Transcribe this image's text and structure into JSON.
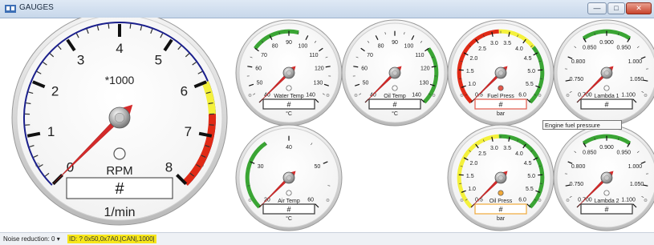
{
  "window": {
    "title": "GAUGES",
    "controls": {
      "minimize": "—",
      "maximize": "□",
      "close": "✕"
    },
    "app_icon": "gauges-app-icon"
  },
  "gauges": [
    {
      "id": "rpm",
      "large": true,
      "label": "RPM",
      "multiplier": "*1000",
      "display": "#",
      "unit": "1/min",
      "value": 0,
      "min": 0,
      "max": 8,
      "tick_labels": [
        "0",
        "1",
        "2",
        "3",
        "4",
        "5",
        "6",
        "7",
        "8"
      ],
      "arc_color": "#1a1f8c",
      "zones": [
        {
          "from": 6,
          "to": 6.6,
          "color": "#f4f13c"
        },
        {
          "from": 6.6,
          "to": 8,
          "color": "#e02a16"
        }
      ],
      "indicator": "off",
      "display_border": "#333333"
    },
    {
      "id": "water-temp",
      "label": "Water Temp",
      "display": "#",
      "unit": "°C",
      "value": 40,
      "min": 40,
      "max": 140,
      "tick_labels": [
        "40",
        "50",
        "60",
        "70",
        "80",
        "90",
        "100",
        "110",
        "120",
        "130",
        "140"
      ],
      "zones": [
        {
          "from": 70,
          "to": 95,
          "color": "#3aa534"
        }
      ],
      "indicator": "off",
      "display_border": "#333333"
    },
    {
      "id": "oil-temp",
      "label": "Oil Temp",
      "display": "#",
      "unit": "°C",
      "value": 40,
      "min": 40,
      "max": 140,
      "tick_labels": [
        "40",
        "50",
        "60",
        "70",
        "80",
        "90",
        "100",
        "110",
        "120",
        "130",
        "140"
      ],
      "zones": [
        {
          "from": 110,
          "to": 140,
          "color": "#3aa534"
        }
      ],
      "indicator": "off",
      "display_border": "#333333"
    },
    {
      "id": "fuel-press",
      "label": "Fuel Press",
      "display": "#",
      "unit": "bar",
      "value": 0.5,
      "min": 0.5,
      "max": 6,
      "tick_labels": [
        "0.5",
        "1.0",
        "1.5",
        "2.0",
        "2.5",
        "3.0",
        "3.5",
        "4.0",
        "4.5",
        "5.0",
        "5.5",
        "6.0"
      ],
      "zones": [
        {
          "from": 0.5,
          "to": 3.2,
          "color": "#e02a16"
        },
        {
          "from": 3.2,
          "to": 4.3,
          "color": "#f4f13c"
        },
        {
          "from": 4.3,
          "to": 6,
          "color": "#3aa534"
        }
      ],
      "indicator": "red",
      "display_border": "#e2584a"
    },
    {
      "id": "lambda-1",
      "label": "Lambda 1",
      "display": "#",
      "unit": "",
      "value": 0.7,
      "min": 0.7,
      "max": 1.1,
      "tick_labels": [
        "0.700",
        "0.750",
        "0.800",
        "0.850",
        "0.900",
        "0.950",
        "1.000",
        "1.050",
        "1.100"
      ],
      "zones": [
        {
          "from": 0.85,
          "to": 0.95,
          "color": "#3aa534"
        }
      ],
      "indicator": "off",
      "display_border": "#333333"
    },
    {
      "id": "air-temp",
      "label": "Air Temp",
      "display": "#",
      "unit": "°C",
      "value": 20,
      "min": 20,
      "max": 60,
      "tick_labels": [
        "20",
        "30",
        "40",
        "50",
        "60"
      ],
      "zones": [
        {
          "from": 20,
          "to": 35,
          "color": "#3aa534"
        }
      ],
      "indicator": "off",
      "display_border": "#333333"
    },
    {
      "id": "oil-press",
      "label": "Oil Press",
      "display": "#",
      "unit": "bar",
      "value": 0.5,
      "min": 0.5,
      "max": 6,
      "tick_labels": [
        "0.5",
        "1.0",
        "1.5",
        "2.0",
        "2.5",
        "3.0",
        "3.5",
        "4.0",
        "4.5",
        "5.0",
        "5.5",
        "6.0"
      ],
      "zones": [
        {
          "from": 0.5,
          "to": 3.2,
          "color": "#f4f13c"
        },
        {
          "from": 3.2,
          "to": 6,
          "color": "#3aa534"
        }
      ],
      "indicator": "yellow",
      "display_border": "#f0a93a"
    },
    {
      "id": "lambda-2",
      "label": "Lambda 2",
      "display": "#",
      "unit": "",
      "value": 0.7,
      "min": 0.7,
      "max": 1.1,
      "tick_labels": [
        "0.700",
        "0.750",
        "0.800",
        "0.850",
        "0.900",
        "0.950",
        "1.000",
        "1.050",
        "1.100"
      ],
      "zones": [
        {
          "from": 0.85,
          "to": 0.95,
          "color": "#3aa534"
        }
      ],
      "indicator": "off",
      "display_border": "#333333"
    }
  ],
  "tooltip": {
    "text": "Engine fuel pressure"
  },
  "status": {
    "noise_label": "Noise reduction: 0",
    "noise_arrow": "▾",
    "id_text": "ID: ? 0x50,0x7A0,|CAN|,1000|"
  },
  "colors": {
    "needle": "#d42a2a",
    "indicator_red": "#e2584a",
    "indicator_yellow": "#f0a93a"
  }
}
